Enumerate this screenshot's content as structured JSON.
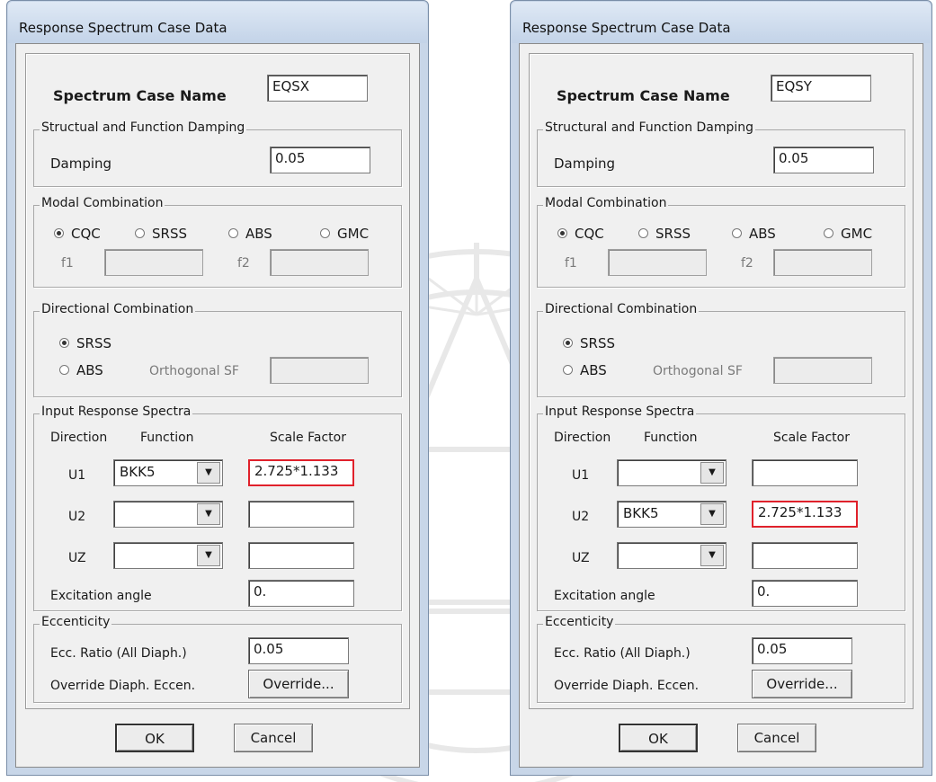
{
  "dialogs": [
    {
      "title": "Response Spectrum Case Data",
      "case_name_label": "Spectrum Case Name",
      "case_name": "EQSX",
      "damping_group": "Structual and Function Damping",
      "damping_label": "Damping",
      "damping_value": "0.05",
      "modal_group": "Modal Combination",
      "modal_options": [
        "CQC",
        "SRSS",
        "ABS",
        "GMC"
      ],
      "modal_selected": "CQC",
      "f1_label": "f1",
      "f2_label": "f2",
      "directional_group": "Directional Combination",
      "directional_options": [
        "SRSS",
        "ABS"
      ],
      "directional_selected": "SRSS",
      "orthogonal_label": "Orthogonal SF",
      "input_group": "Input Response Spectra",
      "col_direction": "Direction",
      "col_function": "Function",
      "col_scale": "Scale Factor",
      "rows": [
        {
          "dir": "U1",
          "function": "BKK5",
          "scale": "2.725*1.133",
          "highlight": true
        },
        {
          "dir": "U2",
          "function": "",
          "scale": "",
          "highlight": false
        },
        {
          "dir": "UZ",
          "function": "",
          "scale": "",
          "highlight": false
        }
      ],
      "excitation_label": "Excitation angle",
      "excitation_value": "0.",
      "ecc_group": "Eccenticity",
      "ecc_label": "Ecc. Ratio (All Diaph.)",
      "ecc_value": "0.05",
      "override_label": "Override Diaph. Eccen.",
      "override_button": "Override...",
      "ok": "OK",
      "cancel": "Cancel"
    },
    {
      "title": "Response Spectrum Case Data",
      "case_name_label": "Spectrum Case Name",
      "case_name": "EQSY",
      "damping_group": "Structural and Function Damping",
      "damping_label": "Damping",
      "damping_value": "0.05",
      "modal_group": "Modal Combination",
      "modal_options": [
        "CQC",
        "SRSS",
        "ABS",
        "GMC"
      ],
      "modal_selected": "CQC",
      "f1_label": "f1",
      "f2_label": "f2",
      "directional_group": "Directional Combination",
      "directional_options": [
        "SRSS",
        "ABS"
      ],
      "directional_selected": "SRSS",
      "orthogonal_label": "Orthogonal SF",
      "input_group": "Input Response Spectra",
      "col_direction": "Direction",
      "col_function": "Function",
      "col_scale": "Scale Factor",
      "rows": [
        {
          "dir": "U1",
          "function": "",
          "scale": "",
          "highlight": false
        },
        {
          "dir": "U2",
          "function": "BKK5",
          "scale": "2.725*1.133",
          "highlight": true
        },
        {
          "dir": "UZ",
          "function": "",
          "scale": "",
          "highlight": false
        }
      ],
      "excitation_label": "Excitation angle",
      "excitation_value": "0.",
      "ecc_group": "Eccenticity",
      "ecc_label": "Ecc. Ratio (All Diaph.)",
      "ecc_value": "0.05",
      "override_label": "Override Diaph. Eccen.",
      "override_button": "Override...",
      "ok": "OK",
      "cancel": "Cancel"
    }
  ],
  "colors": {
    "highlight_border": "#e0212b",
    "title_bar": "#c8d6e8",
    "dialog_bg": "#f0f0f0"
  },
  "icons": {
    "dropdown": "chevron-down-icon",
    "watermark": "university-seal-watermark"
  }
}
